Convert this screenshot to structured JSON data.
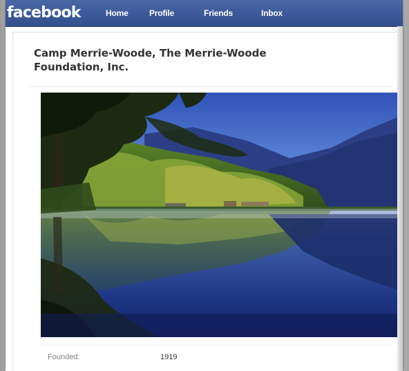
{
  "header": {
    "logo": "facebook",
    "nav": [
      "Home",
      "Profile",
      "Friends",
      "Inbox"
    ]
  },
  "page": {
    "title": "Camp Merrie-Woode, The Merrie-Woode Foundation, Inc.",
    "info": {
      "founded_label": "Founded:",
      "founded_value": "1919"
    }
  },
  "colors": {
    "brand": "#3b5998",
    "title_text": "#333333",
    "label_text": "#808080"
  }
}
